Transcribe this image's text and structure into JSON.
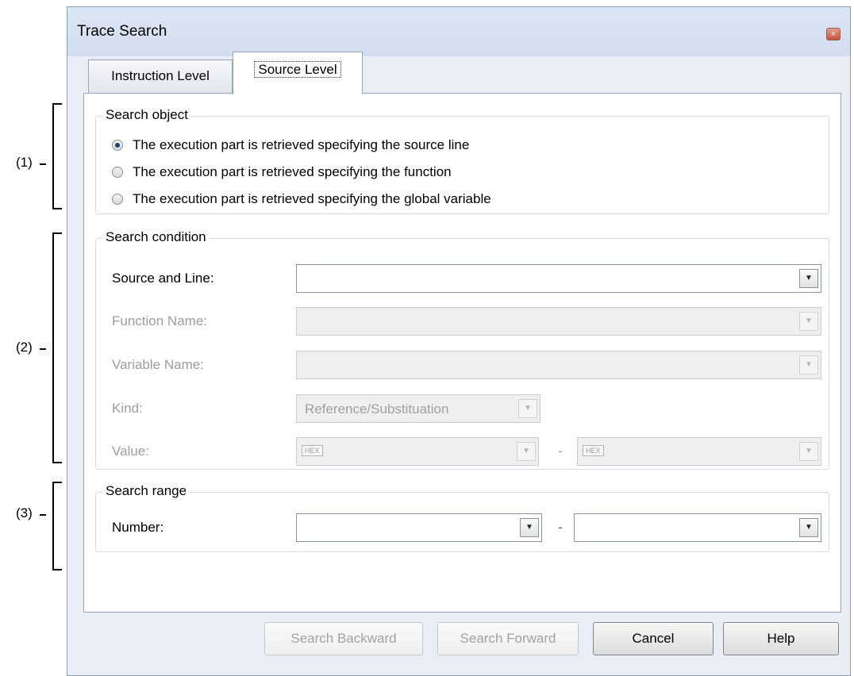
{
  "annotations": [
    "(1)",
    "(2)",
    "(3)"
  ],
  "window": {
    "title": "Trace Search",
    "close_glyph": "×"
  },
  "tabs": [
    {
      "label": "Instruction Level",
      "active": false
    },
    {
      "label": "Source Level",
      "active": true
    }
  ],
  "search_object": {
    "title": "Search object",
    "options": [
      {
        "label": "The execution part is retrieved specifying the source line",
        "checked": true
      },
      {
        "label": "The execution part is retrieved specifying the function",
        "checked": false
      },
      {
        "label": "The execution part is retrieved specifying the global variable",
        "checked": false
      }
    ]
  },
  "search_condition": {
    "title": "Search condition",
    "source_label": "Source and Line:",
    "source_value": "",
    "function_label": "Function Name:",
    "function_value": "",
    "variable_label": "Variable Name:",
    "variable_value": "",
    "kind_label": "Kind:",
    "kind_value": "Reference/Substituation",
    "value_label": "Value:",
    "hex_badge": "HEX",
    "range_separator": "-"
  },
  "search_range": {
    "title": "Search range",
    "number_label": "Number:",
    "from_value": "",
    "to_value": "",
    "range_separator": "-"
  },
  "buttons": {
    "search_backward": "Search Backward",
    "search_forward": "Search Forward",
    "cancel": "Cancel",
    "help": "Help"
  },
  "icons": {
    "dropdown": "chevron-down-icon",
    "close": "close-icon",
    "radio": "radio-icon"
  },
  "colors": {
    "window_bg": "#e9eef6",
    "panel_bg": "#ffffff",
    "disabled_text": "#9d9d9d"
  }
}
